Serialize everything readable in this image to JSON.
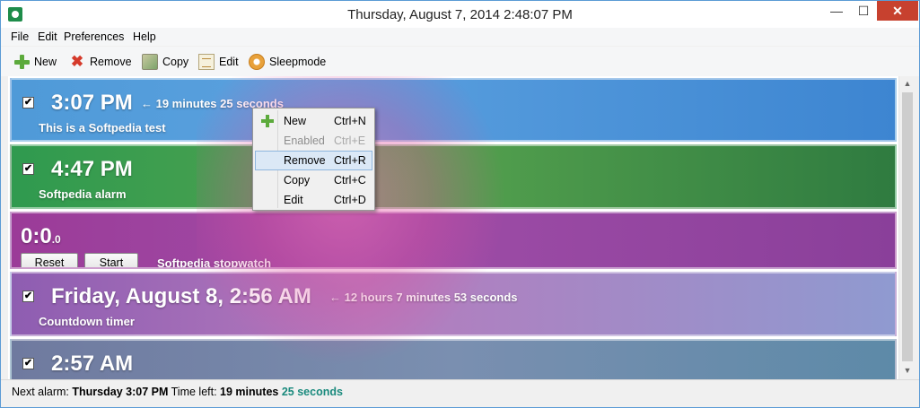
{
  "window": {
    "title": "Thursday, August 7, 2014  2:48:07 PM",
    "min_glyph": "—",
    "max_glyph": "☐",
    "close_glyph": "✕"
  },
  "menu": [
    "File",
    "Edit",
    "Preferences",
    "Help"
  ],
  "toolbar": {
    "new_label": "New",
    "remove_label": "Remove",
    "remove_glyph": "✖",
    "copy_label": "Copy",
    "edit_label": "Edit",
    "sleep_label": "Sleepmode"
  },
  "alarms": [
    {
      "time": "3:07 PM",
      "remaining": "← 19 minutes 25 seconds",
      "label": "This is a Softpedia test",
      "checked": "✔"
    },
    {
      "time": "4:47 PM",
      "label": "Softpedia alarm",
      "checked": "✔"
    },
    {
      "time": "Friday, August 8,  2:56 AM",
      "remaining": "← 12 hours 7 minutes 53 seconds",
      "label": "Countdown timer",
      "checked": "✔"
    },
    {
      "time": "2:57 AM",
      "checked": "✔"
    }
  ],
  "stopwatch": {
    "value_main": "0:0",
    "value_sub": ".0",
    "reset_label": "Reset",
    "start_label": "Start",
    "label": "Softpedia stopwatch"
  },
  "context_menu": [
    {
      "label": "New",
      "shortcut": "Ctrl+N"
    },
    {
      "label": "Enabled",
      "shortcut": "Ctrl+E"
    },
    {
      "label": "Remove",
      "shortcut": "Ctrl+R"
    },
    {
      "label": "Copy",
      "shortcut": "Ctrl+C"
    },
    {
      "label": "Edit",
      "shortcut": "Ctrl+D"
    }
  ],
  "status": {
    "next_label": "Next alarm:",
    "next_value": "Thursday 3:07 PM",
    "left_label": "Time left:",
    "left_minutes": "19 minutes",
    "left_seconds": "25 seconds"
  },
  "scrollbar": {
    "up_glyph": "▲",
    "down_glyph": "▼"
  },
  "colors": {
    "accent": "#5b9bd5",
    "close": "#c7412f",
    "seconds_text": "#1a8a7d"
  }
}
